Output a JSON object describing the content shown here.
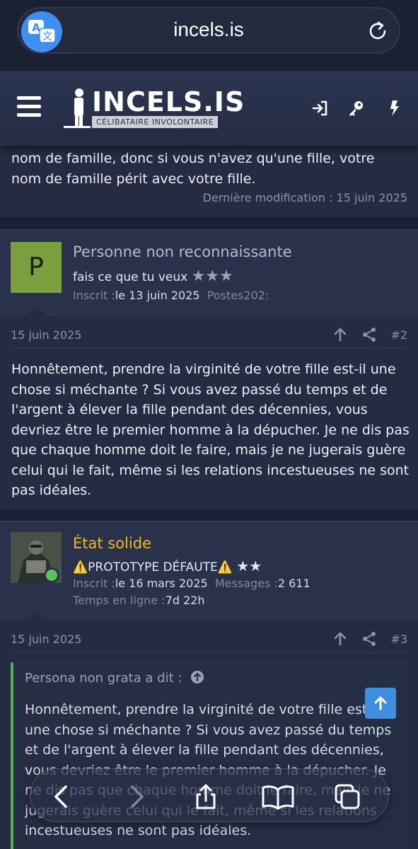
{
  "browser": {
    "url": "incels.is"
  },
  "site": {
    "logo_text": "INCELS.IS",
    "logo_subtitle": "CÉLIBATAIRE INVOLONTAIRE"
  },
  "previous_post": {
    "text": "nom de famille, donc si vous n'avez qu'une fille, votre nom de famille périt avec votre fille.",
    "edited": "Dernière modification : 15 juin 2025"
  },
  "post2": {
    "avatar_letter": "P",
    "username": "Personne non reconnaissante",
    "user_title": "fais ce que tu veux",
    "stars": "★★★",
    "joined_label": "Inscrit :",
    "joined_value": "le 13 juin 2025",
    "posts_label": "Postes",
    "posts_value": "202:",
    "date": "15 juin 2025",
    "number": "#2",
    "body": "Honnêtement, prendre la virginité de votre fille est-il une chose si méchante ? Si vous avez passé du temps et de l'argent à élever la fille pendant des décennies, vous devriez être le premier homme à la dépucher. Je ne dis pas que chaque homme doit le faire, mais je ne jugerais guère celui qui le fait, même si les relations incestueuses ne sont pas idéales."
  },
  "post3": {
    "username": "État solide",
    "user_title": "⚠️PROTOTYPE DÉFAUTE⚠️",
    "stars": "★★",
    "joined_label": "Inscrit :",
    "joined_value": "le 16 mars 2025",
    "messages_label": "Messages :",
    "messages_value": "2 611",
    "online_label": "Temps en ligne :",
    "online_value": "7d 22h",
    "date": "15 juin 2025",
    "number": "#3",
    "quote_author": "Persona non grata a dit :",
    "quote_text": "Honnêtement, prendre la virginité de votre fille est-il une chose si méchante ? Si vous avez passé du temps et de l'argent à élever la fille pendant des décennies, vous devriez être le premier homme à la dépucher. Je ne dis pas que chaque homme doit le faire, mais je ne jugerais guère celui qui le fait, même si les relations incestueuses ne sont pas idéales."
  },
  "colors": {
    "accent_blue": "#3d8ff0",
    "username_gold": "#f1b81e",
    "username_grey": "#b5bac6",
    "online_green": "#5cc25a",
    "quote_bar": "#55b04f"
  },
  "icons": {
    "translate": "translate-icon",
    "reload": "reload-icon",
    "menu": "hamburger-icon",
    "login": "login-icon",
    "register": "key-icon",
    "whats_new": "bolt-icon",
    "upvote": "arrow-up-icon",
    "share": "share-icon",
    "back": "chevron-left-icon",
    "forward": "chevron-right-icon",
    "share_sheet": "share-sheet-icon",
    "bookmarks": "book-icon",
    "tabs": "tabs-icon"
  }
}
